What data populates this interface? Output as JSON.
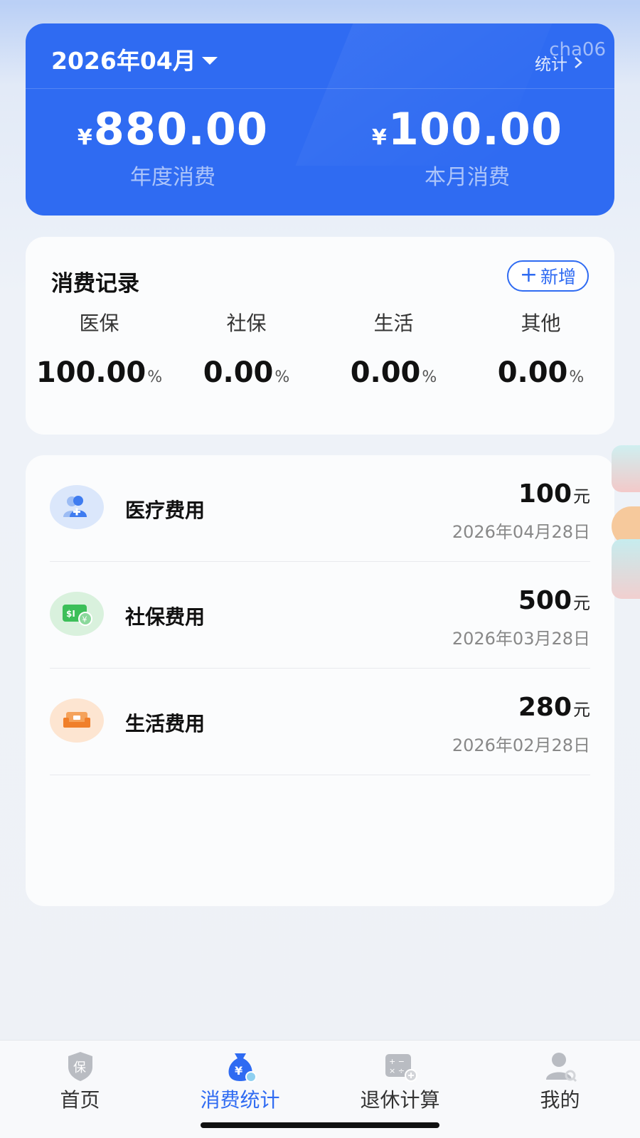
{
  "summary": {
    "month": "2026年04月",
    "stats_link": "统计",
    "watermark": "cha06",
    "currency_symbol": "¥",
    "annual_amount": "880.00",
    "annual_label": "年度消费",
    "monthly_amount": "100.00",
    "monthly_label": "本月消费"
  },
  "records": {
    "title": "消费记录",
    "add_label": "新增",
    "categories": [
      {
        "name": "医保",
        "percent": "100.00",
        "unit": "%"
      },
      {
        "name": "社保",
        "percent": "0.00",
        "unit": "%"
      },
      {
        "name": "生活",
        "percent": "0.00",
        "unit": "%"
      },
      {
        "name": "其他",
        "percent": "0.00",
        "unit": "%"
      }
    ]
  },
  "expenses": [
    {
      "name": "医疗费用",
      "amount": "100",
      "unit": "元",
      "date": "2026年04月28日",
      "icon": "medical-person-icon"
    },
    {
      "name": "社保费用",
      "amount": "500",
      "unit": "元",
      "date": "2026年03月28日",
      "icon": "social-card-icon"
    },
    {
      "name": "生活费用",
      "amount": "280",
      "unit": "元",
      "date": "2026年02月28日",
      "icon": "sofa-icon"
    }
  ],
  "tabs": [
    {
      "label": "首页",
      "icon": "shield-icon",
      "active": false
    },
    {
      "label": "消费统计",
      "icon": "money-bag-icon",
      "active": true
    },
    {
      "label": "退休计算",
      "icon": "calculator-icon",
      "active": false
    },
    {
      "label": "我的",
      "icon": "user-icon",
      "active": false
    }
  ],
  "colors": {
    "primary": "#2f6bf2",
    "medical_bg": "#dbe7fb",
    "social_bg": "#d9f1dd",
    "life_bg": "#fde5d1"
  }
}
